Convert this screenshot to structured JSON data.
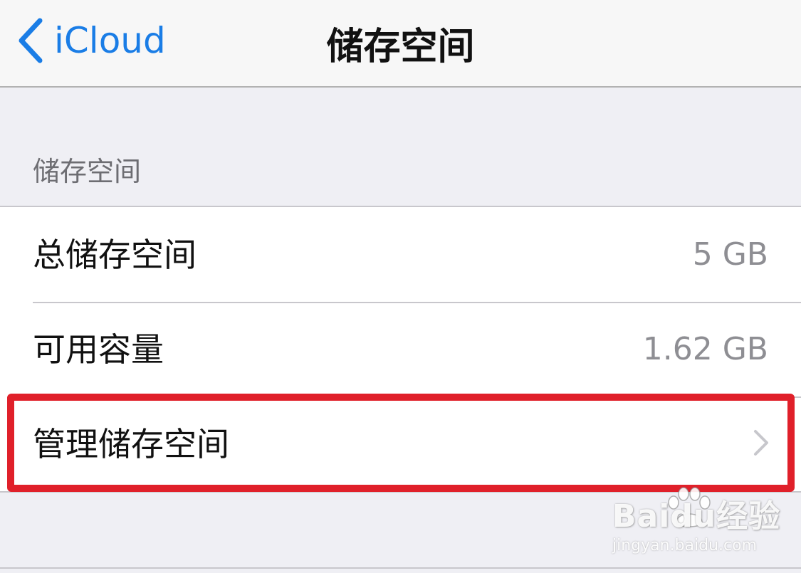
{
  "navbar": {
    "back_label": "iCloud",
    "title": "储存空间",
    "accent_color": "#1a7de6"
  },
  "section": {
    "header": "储存空间",
    "rows": [
      {
        "label": "总储存空间",
        "value": "5 GB"
      },
      {
        "label": "可用容量",
        "value": "1.62 GB"
      },
      {
        "label": "管理储存空间",
        "value": "",
        "disclosure_icon": "chevron-right-icon"
      }
    ]
  },
  "annotation": {
    "highlight_color": "#e0202a",
    "highlighted_row": "管理储存空间"
  },
  "watermark": {
    "brand": "Baidu经验",
    "url": "jingyan.baidu.com"
  }
}
